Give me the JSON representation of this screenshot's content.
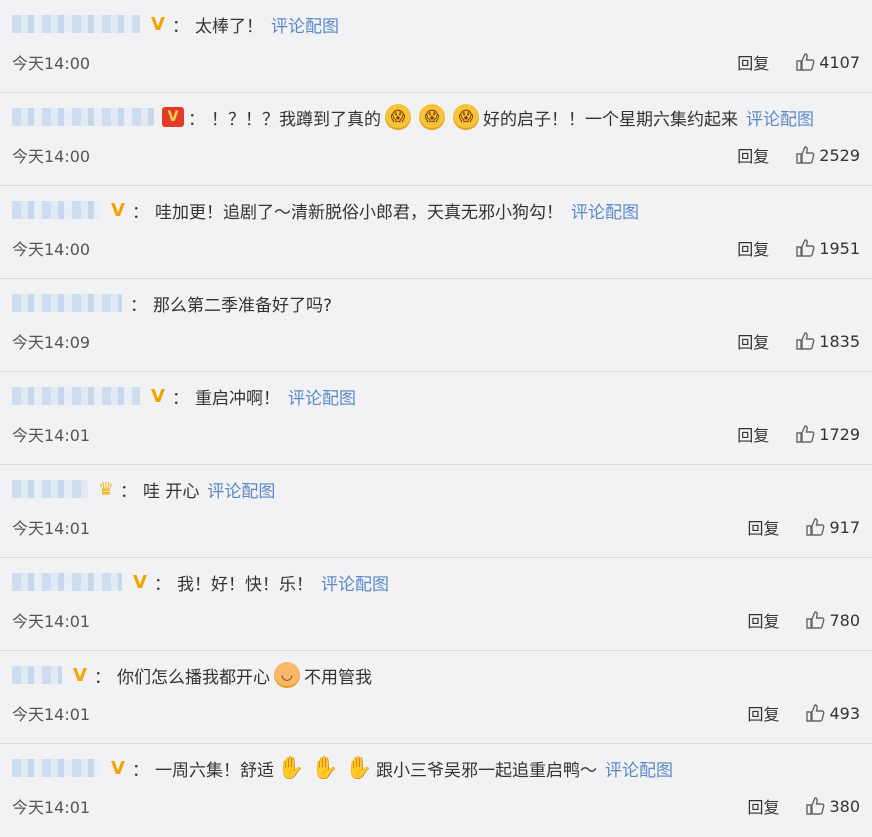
{
  "ui": {
    "reply_label": "回复",
    "pic_label": "评论配图",
    "colon": "："
  },
  "colors": {
    "link": "#5a8ac6",
    "vip_badge": "#f0a400",
    "background": "#f2f2f5"
  },
  "comments": [
    {
      "badge": "V",
      "text_parts": [
        "太棒了！"
      ],
      "has_pic": true,
      "time": "今天14:00",
      "likes": "4107"
    },
    {
      "badge": "V",
      "text_parts": [
        "！？！？我蹲到了真的",
        "好的启子！！一个星期六集约起来"
      ],
      "emojis": [
        "scared-face-icon",
        "scared-face-icon",
        "scared-face-icon"
      ],
      "has_pic": true,
      "time": "今天14:00",
      "likes": "2529"
    },
    {
      "badge": "V",
      "text_parts": [
        "哇加更！追剧了～清新脱俗小郎君，天真无邪小狗勾！"
      ],
      "has_pic": true,
      "time": "今天14:00",
      "likes": "1951"
    },
    {
      "badge": "",
      "text_parts": [
        "那么第二季准备好了吗?"
      ],
      "has_pic": false,
      "time": "今天14:09",
      "likes": "1835"
    },
    {
      "badge": "V",
      "text_parts": [
        "重启冲啊！"
      ],
      "has_pic": true,
      "time": "今天14:01",
      "likes": "1729"
    },
    {
      "badge": "crown",
      "text_parts": [
        "哇 开心"
      ],
      "has_pic": true,
      "time": "今天14:01",
      "likes": "917"
    },
    {
      "badge": "V",
      "text_parts": [
        "我！好！快！乐！"
      ],
      "has_pic": true,
      "time": "今天14:01",
      "likes": "780"
    },
    {
      "badge": "V",
      "text_parts": [
        "你们怎么播我都开心",
        "不用管我"
      ],
      "emojis": [
        "blush-face-icon"
      ],
      "has_pic": false,
      "time": "今天14:01",
      "likes": "493"
    },
    {
      "badge": "V",
      "text_parts": [
        "一周六集！舒适",
        "跟小三爷吴邪一起追重启鸭～"
      ],
      "emojis": [
        "five-hand-icon",
        "five-hand-icon",
        "five-hand-icon"
      ],
      "has_pic": true,
      "time": "今天14:01",
      "likes": "380"
    }
  ]
}
